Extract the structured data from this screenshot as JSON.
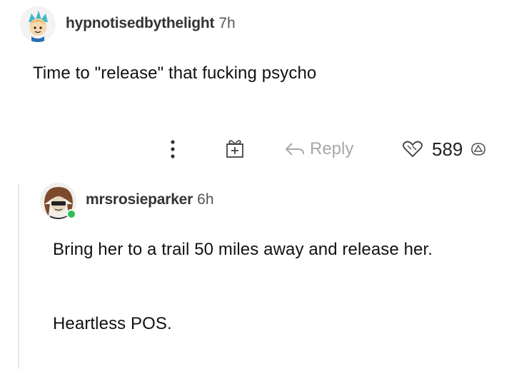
{
  "comment1": {
    "username": "hypnotisedbythelight",
    "time": "7h",
    "text": "Time to \"release\" that fucking psycho",
    "actions": {
      "more_icon": "more-vertical-icon",
      "gift_icon": "gift-icon",
      "reply_icon": "reply-arrow-icon",
      "reply_label": "Reply",
      "heart_icon": "heart-icon",
      "like_count": "589",
      "downvote_icon": "downvote-icon"
    }
  },
  "comment2": {
    "username": "mrsrosieparker",
    "time": "6h",
    "paragraphs": [
      "Bring her to a trail 50 miles away and release her.",
      "Heartless POS."
    ],
    "online": true
  },
  "colors": {
    "text": "#111111",
    "muted": "#a8a8a8",
    "online": "#2ebd59",
    "thread_line": "#e9e9e9"
  }
}
